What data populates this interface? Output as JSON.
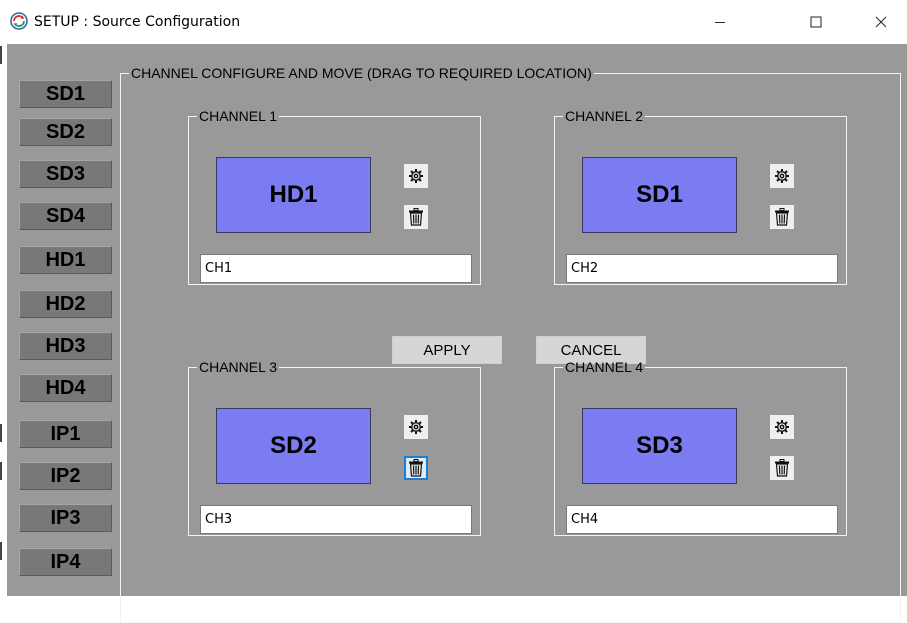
{
  "window": {
    "title": "SETUP : Source Configuration",
    "controls": {
      "minimize": "—",
      "maximize": "☐",
      "close": "✕"
    }
  },
  "sources": [
    "SD1",
    "SD2",
    "SD3",
    "SD4",
    "HD1",
    "HD2",
    "HD3",
    "HD4",
    "IP1",
    "IP2",
    "IP3",
    "IP4"
  ],
  "group_title": "CHANNEL CONFIGURE AND MOVE (DRAG TO REQUIRED LOCATION)",
  "channels": [
    {
      "title": "CHANNEL 1",
      "source": "HD1",
      "name": "CH1"
    },
    {
      "title": "CHANNEL 2",
      "source": "SD1",
      "name": "CH2"
    },
    {
      "title": "CHANNEL 3",
      "source": "SD2",
      "name": "CH3"
    },
    {
      "title": "CHANNEL 4",
      "source": "SD3",
      "name": "CH4"
    }
  ],
  "actions": {
    "apply": "APPLY",
    "cancel": "CANCEL"
  },
  "colors": {
    "client_bg": "#999999",
    "source_button": "#787878",
    "tile": "#7b7bf2",
    "focus": "#1a7ed6"
  },
  "icons": {
    "settings": "gear-icon",
    "delete": "trash-icon",
    "app": "refresh-app-icon"
  }
}
